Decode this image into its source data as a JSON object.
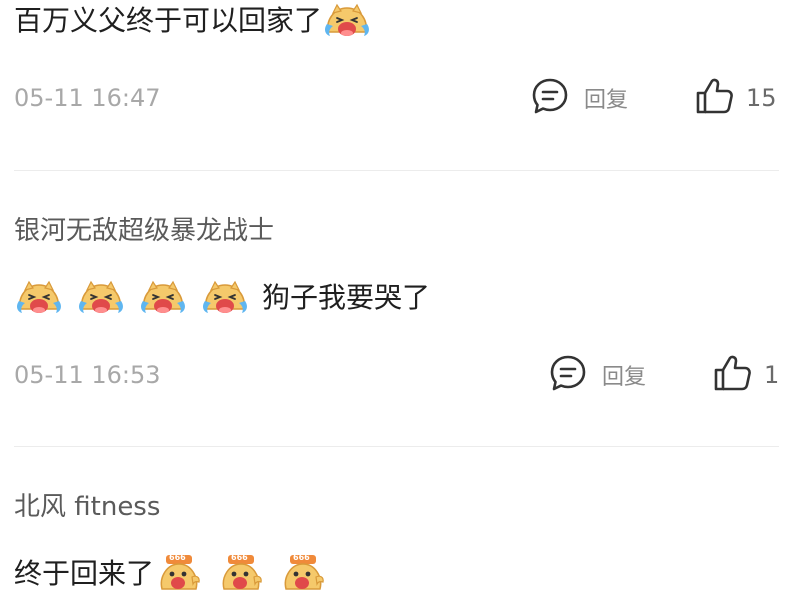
{
  "comments": [
    {
      "author": "",
      "text": "百万义父终于可以回家了",
      "time": "05-11 16:47",
      "reply_label": "回复",
      "likes": "15",
      "emojis": [
        "crying-laughing"
      ]
    },
    {
      "author": "银河无敌超级暴龙战士",
      "text": "狗子我要哭了",
      "time": "05-11 16:53",
      "reply_label": "回复",
      "likes": "1",
      "emojis": [
        "crying-laughing",
        "crying-laughing",
        "crying-laughing",
        "crying-laughing"
      ]
    },
    {
      "author": "北风 fitness",
      "text": "终于回来了",
      "emojis": [
        "666-cheer",
        "666-cheer",
        "666-cheer"
      ],
      "emoji_badge": "666"
    }
  ],
  "icons": {
    "reply": "comment-bubble-icon",
    "like": "thumbs-up-icon"
  },
  "colors": {
    "text": "#1f1f1f",
    "author": "#5a5a5a",
    "meta": "#a8a8a8",
    "divider": "#ececec",
    "emoji_face": "#f5c96b",
    "emoji_mouth": "#e04a4a"
  }
}
